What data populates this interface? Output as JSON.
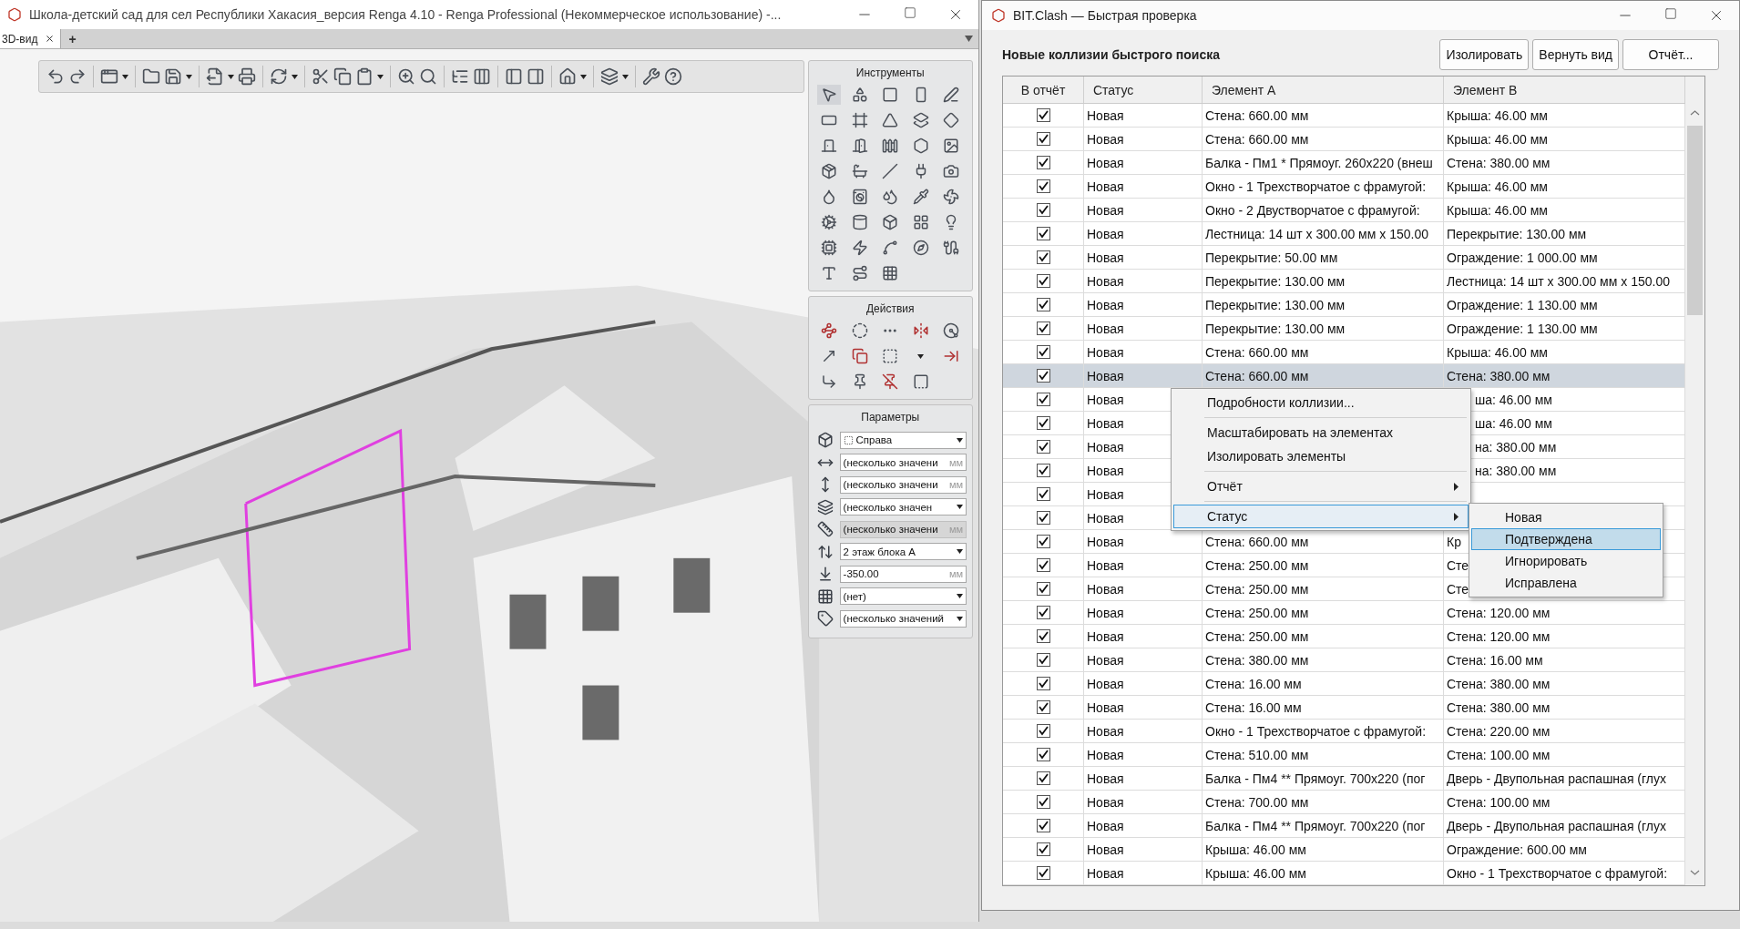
{
  "left_window": {
    "title": "Школа-детский сад для сел Республики Хакасия_версия Renga 4.10 - Renga Professional (Некоммерческое использование) -...",
    "tabs": [
      {
        "label": "3D-вид",
        "selected": true
      }
    ],
    "new_tab": "+",
    "panels": {
      "tools": {
        "title": "Инструменты"
      },
      "actions": {
        "title": "Действия"
      },
      "parameters": {
        "title": "Параметры",
        "fields": [
          {
            "kind": "dropdown",
            "value": "Справа"
          },
          {
            "kind": "input",
            "value": "(несколько значени",
            "unit": "мм",
            "disabled": false
          },
          {
            "kind": "input",
            "value": "(несколько значени",
            "unit": "мм",
            "disabled": false
          },
          {
            "kind": "dropdown",
            "value": "(несколько значен"
          },
          {
            "kind": "input",
            "value": "(несколько значени",
            "unit": "мм",
            "disabled": true
          },
          {
            "kind": "dropdown",
            "value": "2 этаж блока А"
          },
          {
            "kind": "input",
            "value": "-350.00",
            "unit": "мм",
            "disabled": false
          },
          {
            "kind": "dropdown",
            "value": "(нет)"
          },
          {
            "kind": "dropdown",
            "value": "(несколько значений"
          }
        ]
      }
    }
  },
  "right_window": {
    "title": "BIT.Clash — Быстрая проверка",
    "heading": "Новые коллизии быстрого поиска",
    "buttons": [
      "Изолировать",
      "Вернуть вид",
      "Отчёт..."
    ],
    "table": {
      "columns": [
        "В отчёт",
        "Статус",
        "Элемент А",
        "Элемент В"
      ],
      "rows": [
        {
          "checked": true,
          "status": "Новая",
          "element_a": "Стена: 660.00 мм",
          "element_b": "Крыша: 46.00 мм",
          "selected": false
        },
        {
          "checked": true,
          "status": "Новая",
          "element_a": "Стена: 660.00 мм",
          "element_b": "Крыша: 46.00 мм",
          "selected": false
        },
        {
          "checked": true,
          "status": "Новая",
          "element_a": "Балка - Пм1 * Прямоуг. 260x220 (внеш",
          "element_b": "Стена: 380.00 мм",
          "selected": false
        },
        {
          "checked": true,
          "status": "Новая",
          "element_a": "Окно - 1 Трехстворчатое с фрамугой:",
          "element_b": "Крыша: 46.00 мм",
          "selected": false
        },
        {
          "checked": true,
          "status": "Новая",
          "element_a": "Окно - 2 Двустворчатое с фрамугой:",
          "element_b": "Крыша: 46.00 мм",
          "selected": false
        },
        {
          "checked": true,
          "status": "Новая",
          "element_a": "Лестница: 14 шт x 300.00 мм x 150.00",
          "element_b": "Перекрытие: 130.00 мм",
          "selected": false
        },
        {
          "checked": true,
          "status": "Новая",
          "element_a": "Перекрытие: 50.00 мм",
          "element_b": "Ограждение: 1 000.00 мм",
          "selected": false
        },
        {
          "checked": true,
          "status": "Новая",
          "element_a": "Перекрытие: 130.00 мм",
          "element_b": "Лестница: 14 шт x 300.00 мм x 150.00",
          "selected": false
        },
        {
          "checked": true,
          "status": "Новая",
          "element_a": "Перекрытие: 130.00 мм",
          "element_b": "Ограждение: 1 130.00 мм",
          "selected": false
        },
        {
          "checked": true,
          "status": "Новая",
          "element_a": "Перекрытие: 130.00 мм",
          "element_b": "Ограждение: 1 130.00 мм",
          "selected": false
        },
        {
          "checked": true,
          "status": "Новая",
          "element_a": "Стена: 660.00 мм",
          "element_b": "Крыша: 46.00 мм",
          "selected": false
        },
        {
          "checked": true,
          "status": "Новая",
          "element_a": "Стена: 660.00 мм",
          "element_b": "Стена: 380.00 мм",
          "selected": true
        },
        {
          "checked": true,
          "status": "Новая",
          "element_b": "ша: 46.00 мм",
          "element_b_covered_left": true,
          "selected": false
        },
        {
          "checked": true,
          "status": "Новая",
          "element_b": "ша: 46.00 мм",
          "element_b_covered_left": true,
          "selected": false
        },
        {
          "checked": true,
          "status": "Новая",
          "element_b": "на: 380.00 мм",
          "element_b_covered_left": true,
          "selected": false
        },
        {
          "checked": true,
          "status": "Новая",
          "element_b": "на: 380.00 мм",
          "element_b_covered_left": true,
          "selected": false
        },
        {
          "checked": true,
          "status": "Новая",
          "selected": false
        },
        {
          "checked": true,
          "status": "Новая",
          "selected": false
        },
        {
          "checked": true,
          "status": "Новая",
          "element_a": "Стена: 660.00 мм",
          "element_b": "Кр",
          "selected": false
        },
        {
          "checked": true,
          "status": "Новая",
          "element_a": "Стена: 250.00 мм",
          "element_b": "Сте",
          "selected": false
        },
        {
          "checked": true,
          "status": "Новая",
          "element_a": "Стена: 250.00 мм",
          "element_b": "Сте",
          "selected": false
        },
        {
          "checked": true,
          "status": "Новая",
          "element_a": "Стена: 250.00 мм",
          "element_b": "Стена: 120.00 мм",
          "selected": false
        },
        {
          "checked": true,
          "status": "Новая",
          "element_a": "Стена: 250.00 мм",
          "element_b": "Стена: 120.00 мм",
          "selected": false
        },
        {
          "checked": true,
          "status": "Новая",
          "element_a": "Стена: 380.00 мм",
          "element_b": "Стена: 16.00 мм",
          "selected": false
        },
        {
          "checked": true,
          "status": "Новая",
          "element_a": "Стена: 16.00 мм",
          "element_b": "Стена: 380.00 мм",
          "selected": false
        },
        {
          "checked": true,
          "status": "Новая",
          "element_a": "Стена: 16.00 мм",
          "element_b": "Стена: 380.00 мм",
          "selected": false
        },
        {
          "checked": true,
          "status": "Новая",
          "element_a": "Окно - 1 Трехстворчатое с фрамугой:",
          "element_b": "Стена: 220.00 мм",
          "selected": false
        },
        {
          "checked": true,
          "status": "Новая",
          "element_a": "Стена: 510.00 мм",
          "element_b": "Стена: 100.00 мм",
          "selected": false
        },
        {
          "checked": true,
          "status": "Новая",
          "element_a": "Балка - Пм4 ** Прямоуг. 700x220 (пог",
          "element_b": "Дверь - Двупольная распашная (глух",
          "selected": false
        },
        {
          "checked": true,
          "status": "Новая",
          "element_a": "Стена: 700.00 мм",
          "element_b": "Стена: 100.00 мм",
          "selected": false
        },
        {
          "checked": true,
          "status": "Новая",
          "element_a": "Балка - Пм4 ** Прямоуг. 700x220 (пог",
          "element_b": "Дверь - Двупольная распашная (глух",
          "selected": false
        },
        {
          "checked": true,
          "status": "Новая",
          "element_a": "Крыша: 46.00 мм",
          "element_b": "Ограждение: 600.00 мм",
          "selected": false
        },
        {
          "checked": true,
          "status": "Новая",
          "element_a": "Крыша: 46.00 мм",
          "element_b": "Окно - 1 Трехстворчатое с фрамугой:",
          "selected": false
        }
      ]
    },
    "context_menu": {
      "items": [
        {
          "kind": "item",
          "label": "Подробности коллизии...",
          "submenu": false,
          "selected": false
        },
        {
          "kind": "separator"
        },
        {
          "kind": "item",
          "label": "Масштабировать на элементах",
          "submenu": false,
          "selected": false
        },
        {
          "kind": "item",
          "label": "Изолировать элементы",
          "submenu": false,
          "selected": false
        },
        {
          "kind": "separator"
        },
        {
          "kind": "item",
          "label": "Отчёт",
          "submenu": true,
          "selected": false
        },
        {
          "kind": "separator"
        },
        {
          "kind": "item",
          "label": "Статус",
          "submenu": true,
          "selected": true
        }
      ],
      "submenu": {
        "items": [
          {
            "label": "Новая",
            "selected": false
          },
          {
            "label": "Подтверждена",
            "selected": true
          },
          {
            "label": "Игнорировать",
            "selected": false
          },
          {
            "label": "Исправлена",
            "selected": false
          }
        ]
      }
    }
  }
}
